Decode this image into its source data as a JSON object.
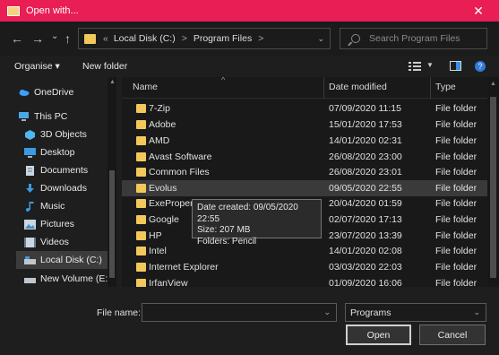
{
  "window": {
    "title": "Open with...",
    "close_glyph": "✕"
  },
  "nav": {
    "back": "←",
    "forward": "→",
    "recent": "⌄",
    "up": "↑"
  },
  "address": {
    "root_glyph": "«",
    "crumbs": [
      "Local Disk (C:)",
      "Program Files"
    ],
    "sep": ">"
  },
  "search": {
    "placeholder": "Search Program Files"
  },
  "toolbar": {
    "organise": "Organise ▾",
    "new_folder": "New folder"
  },
  "sidebar": {
    "items": [
      {
        "label": "OneDrive",
        "icon": "cloud-icon",
        "color": "#3aa0ff"
      },
      {
        "label": "This PC",
        "icon": "pc-icon",
        "color": "#4aa8e8"
      },
      {
        "label": "3D Objects",
        "icon": "cube-icon",
        "color": "#4fb6f2"
      },
      {
        "label": "Desktop",
        "icon": "desktop-icon",
        "color": "#3b9ae0"
      },
      {
        "label": "Documents",
        "icon": "document-icon",
        "color": "#c9d6e3"
      },
      {
        "label": "Downloads",
        "icon": "download-icon",
        "color": "#3b9ae0"
      },
      {
        "label": "Music",
        "icon": "music-icon",
        "color": "#3b9ae0"
      },
      {
        "label": "Pictures",
        "icon": "picture-icon",
        "color": "#c9d6e3"
      },
      {
        "label": "Videos",
        "icon": "video-icon",
        "color": "#c9d6e3"
      },
      {
        "label": "Local Disk (C:)",
        "icon": "drive-icon",
        "color": "#bfc6cc"
      },
      {
        "label": "New Volume (E:)",
        "icon": "drive-icon",
        "color": "#bfc6cc"
      }
    ]
  },
  "columns": {
    "name": "Name",
    "date": "Date modified",
    "type": "Type"
  },
  "files": [
    {
      "name": "7-Zip",
      "date": "07/09/2020 11:15",
      "type": "File folder"
    },
    {
      "name": "Adobe",
      "date": "15/01/2020 17:53",
      "type": "File folder"
    },
    {
      "name": "AMD",
      "date": "14/01/2020 02:31",
      "type": "File folder"
    },
    {
      "name": "Avast Software",
      "date": "26/08/2020 23:00",
      "type": "File folder"
    },
    {
      "name": "Common Files",
      "date": "26/08/2020 23:01",
      "type": "File folder"
    },
    {
      "name": "Evolus",
      "date": "09/05/2020 22:55",
      "type": "File folder"
    },
    {
      "name": "ExePropert",
      "date": "20/04/2020 01:59",
      "type": "File folder"
    },
    {
      "name": "Google",
      "date": "02/07/2020 17:13",
      "type": "File folder"
    },
    {
      "name": "HP",
      "date": "23/07/2020 13:39",
      "type": "File folder"
    },
    {
      "name": "Intel",
      "date": "14/01/2020 02:08",
      "type": "File folder"
    },
    {
      "name": "Internet Explorer",
      "date": "03/03/2020 22:03",
      "type": "File folder"
    },
    {
      "name": "IrfanView",
      "date": "01/09/2020 16:06",
      "type": "File folder"
    }
  ],
  "tooltip": {
    "created": "Date created: 09/05/2020 22:55",
    "size": "Size: 207 MB",
    "folders": "Folders: Pencil"
  },
  "bottom": {
    "file_name_label": "File name:",
    "file_name_value": "",
    "filter_value": "Programs",
    "open_label": "Open",
    "cancel_label": "Cancel"
  }
}
